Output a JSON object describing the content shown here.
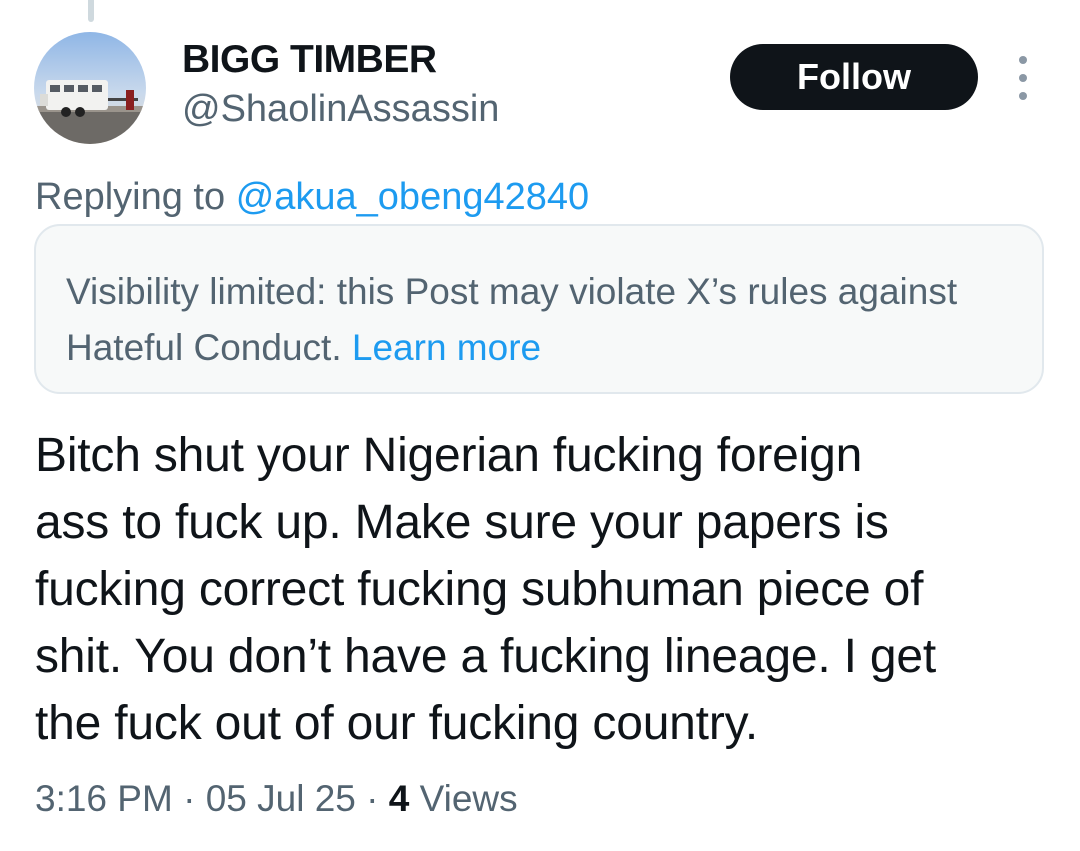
{
  "author": {
    "display_name": "BIGG TIMBER",
    "handle": "@ShaolinAssassin"
  },
  "follow_label": "Follow",
  "icons": {
    "avatar": "horse-trailer-avatar",
    "more": "more-vertical-icon"
  },
  "reply": {
    "prefix": "Replying to",
    "mention": "@akua_obeng42840"
  },
  "notice": {
    "text": "Visibility limited: this Post may violate X’s rules against Hateful Conduct.",
    "link": "Learn more"
  },
  "tweet": {
    "lines": [
      "Bitch shut your Nigerian fucking foreign",
      "ass to fuck up. Make sure your papers is",
      "fucking correct fucking subhuman piece of",
      "shit. You don’t have a fucking lineage. I get",
      "the fuck out of our fucking country."
    ]
  },
  "meta": {
    "time": "3:16 PM",
    "sep1": " · ",
    "date": "05 Jul 25",
    "sep2": " · ",
    "views_count": "4",
    "views_label": "Views"
  },
  "colors": {
    "text_primary": "#0f1419",
    "text_secondary": "#536471",
    "link": "#1d9bf0",
    "follow_bg": "#0f1419",
    "notice_bg": "#f7f9f9"
  }
}
